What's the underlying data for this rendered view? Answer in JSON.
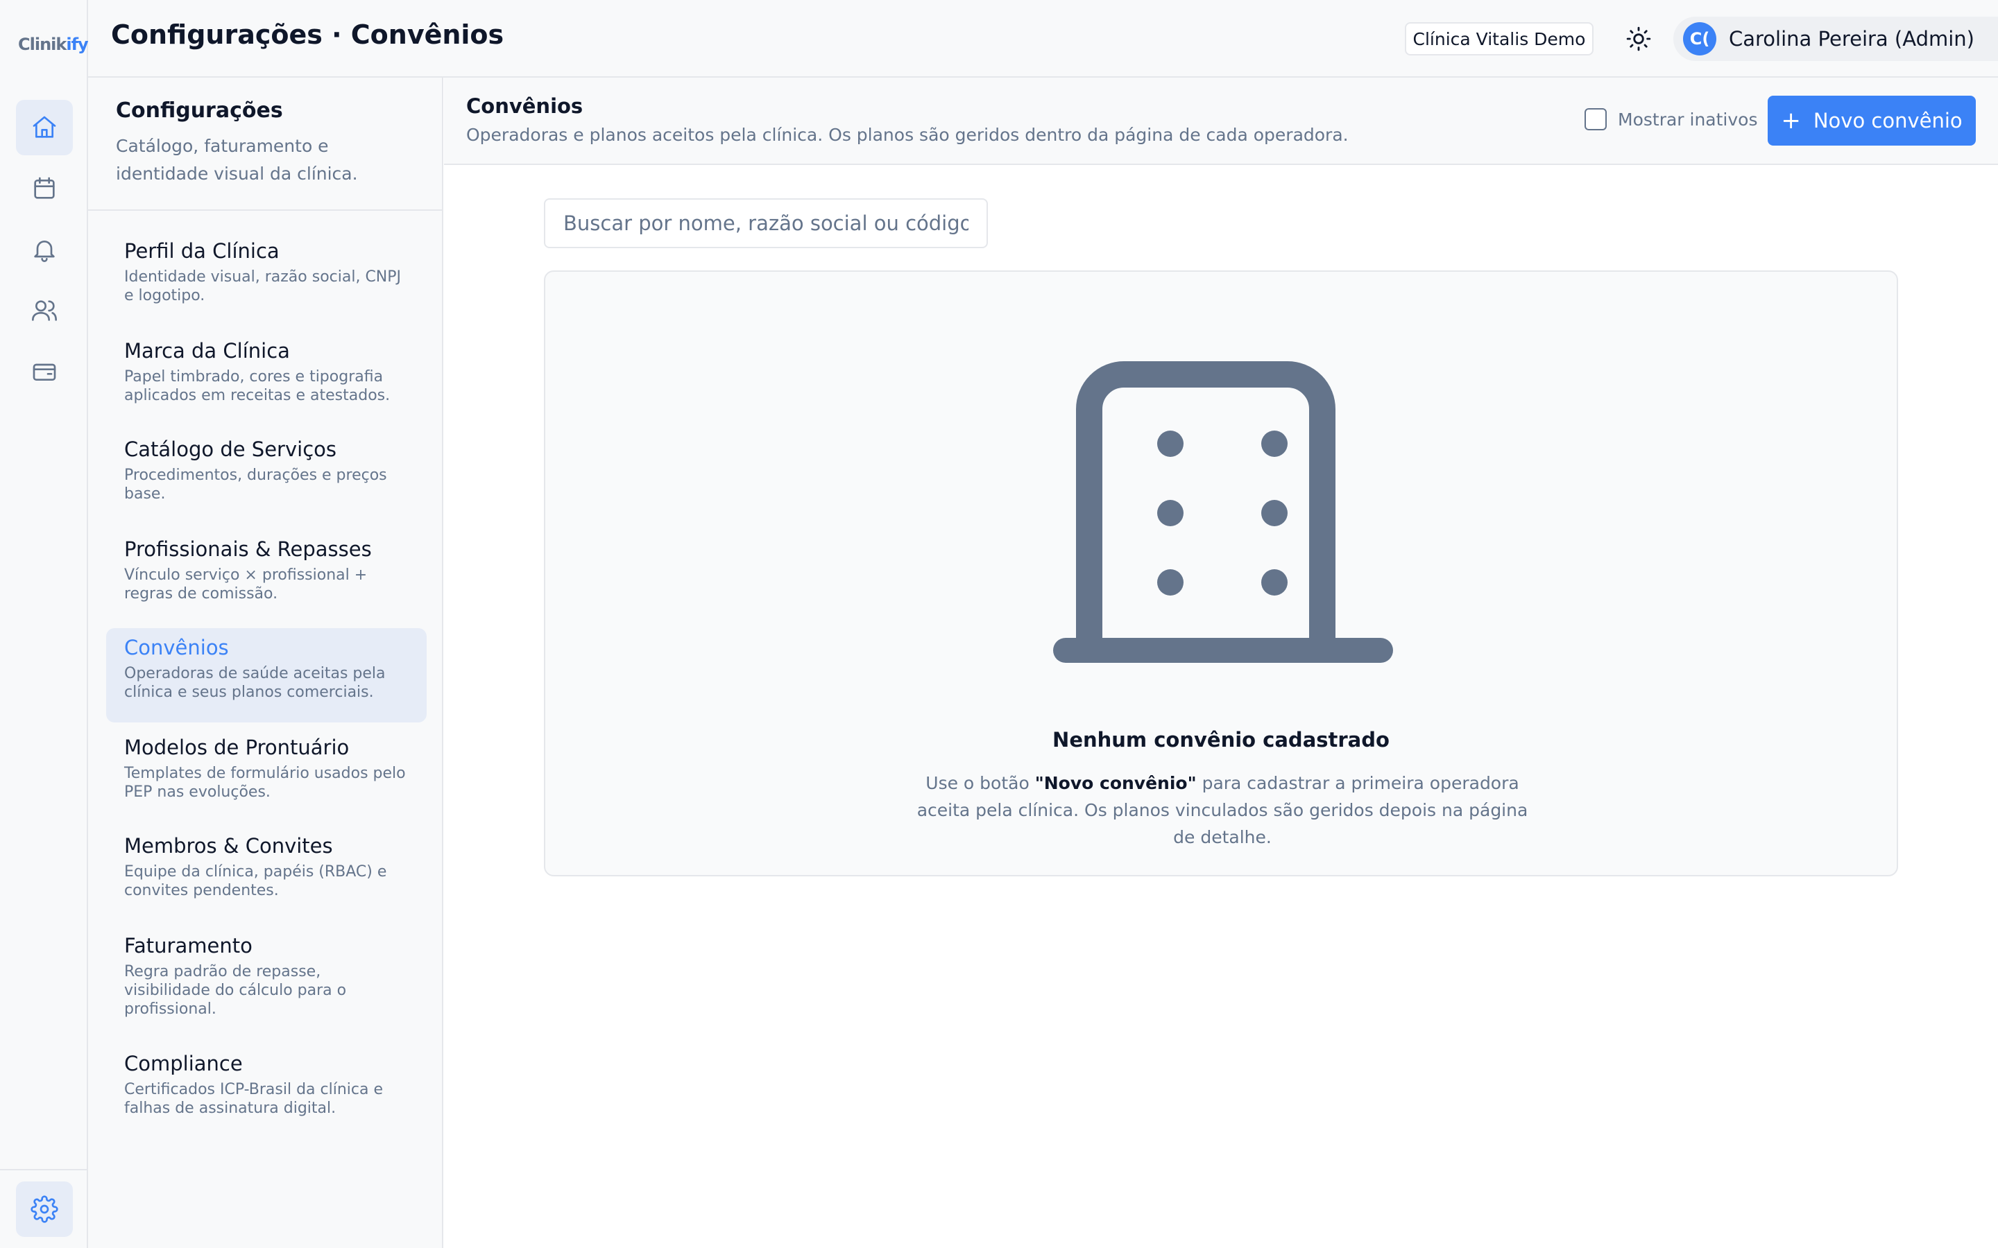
{
  "app": {
    "logo_main": "Clinik",
    "logo_accent": "ify"
  },
  "header": {
    "title": "Configurações · Convênios",
    "clinic": "Clínica Vitalis Demo",
    "user_initials": "C(",
    "user_name": "Carolina Pereira (Admin)"
  },
  "rail": {
    "icons": [
      "home-icon",
      "calendar-icon",
      "bell-icon",
      "users-icon",
      "wallet-icon",
      "gear-icon"
    ]
  },
  "settings": {
    "title": "Configurações",
    "subtitle": "Catálogo, faturamento e identidade visual da clínica.",
    "items": [
      {
        "label": "Perfil da Clínica",
        "desc": "Identidade visual, razão social, CNPJ e logotipo."
      },
      {
        "label": "Marca da Clínica",
        "desc": "Papel timbrado, cores e tipografia aplicados em receitas e atestados."
      },
      {
        "label": "Catálogo de Serviços",
        "desc": "Procedimentos, durações e preços base."
      },
      {
        "label": "Profissionais & Repasses",
        "desc": "Vínculo serviço × profissional + regras de comissão."
      },
      {
        "label": "Convênios",
        "desc": "Operadoras de saúde aceitas pela clínica e seus planos comerciais."
      },
      {
        "label": "Modelos de Prontuário",
        "desc": "Templates de formulário usados pelo PEP nas evoluções."
      },
      {
        "label": "Membros & Convites",
        "desc": "Equipe da clínica, papéis (RBAC) e convites pendentes."
      },
      {
        "label": "Faturamento",
        "desc": "Regra padrão de repasse, visibilidade do cálculo para o profissional."
      },
      {
        "label": "Compliance",
        "desc": "Certificados ICP-Brasil da clínica e falhas de assinatura digital."
      }
    ]
  },
  "content": {
    "title": "Convênios",
    "subtitle": "Operadoras e planos aceitos pela clínica. Os planos são geridos dentro da página de cada operadora.",
    "show_inactive_label": "Mostrar inativos",
    "show_inactive_checked": false,
    "new_button_label": "Novo convênio",
    "search_placeholder": "Buscar por nome, razão social ou código",
    "search_value": "",
    "empty": {
      "title": "Nenhum convênio cadastrado",
      "desc_before": "Use o botão ",
      "desc_bold": "\"Novo convênio\"",
      "desc_after": " para cadastrar a primeira operadora aceita pela clínica. Os planos vinculados são geridos depois na página de detalhe."
    }
  },
  "colors": {
    "accent": "#3b82f6",
    "active_bg": "#e6ecf7",
    "muted_text": "#64748b",
    "border": "#e5e7eb"
  }
}
